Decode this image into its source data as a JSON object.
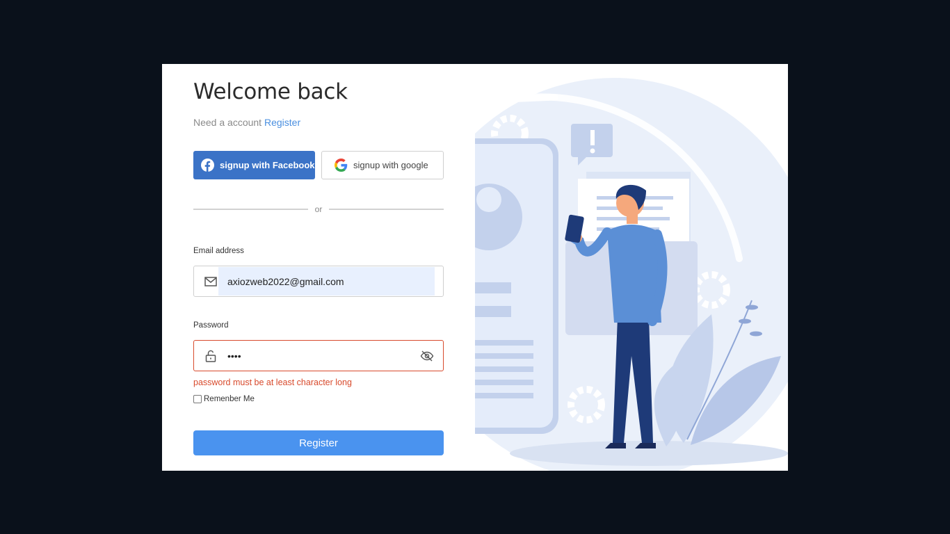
{
  "heading": "Welcome back",
  "subtitle": {
    "prompt": "Need a account",
    "link": "Register"
  },
  "social": {
    "facebook_label": "signup with Facebook",
    "google_label": "signup with google"
  },
  "divider_text": "or",
  "email": {
    "label": "Email address",
    "value": "axiozweb2022@gmail.com"
  },
  "password": {
    "label": "Password",
    "value": "••••",
    "error": "password must be at least character long"
  },
  "remember_label": "Remenber Me",
  "submit_label": "Register",
  "colors": {
    "background": "#0a111b",
    "facebook": "#3b73c7",
    "primary": "#4a93ef",
    "error": "#d84a2c",
    "link": "#4a8fe0"
  },
  "icons": [
    "facebook-icon",
    "google-icon",
    "mail-icon",
    "lock-icon",
    "eye-off-icon"
  ]
}
